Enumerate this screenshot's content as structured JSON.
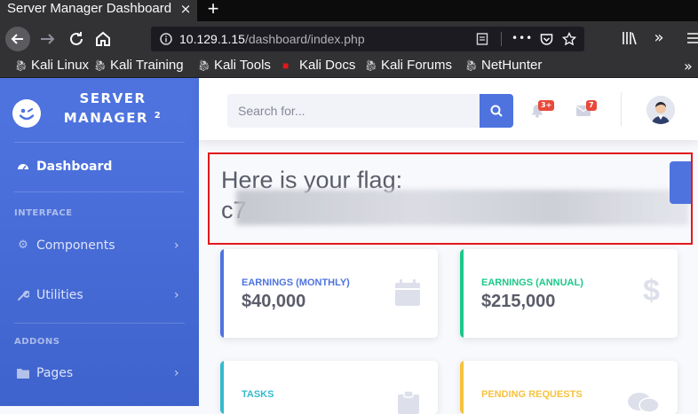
{
  "browser": {
    "tab_title": "Server Manager Dashboard",
    "tab_close": "×",
    "new_tab": "+",
    "url_host": "10.129.1.15",
    "url_path": "/dashboard/index.php",
    "page_actions": "•••",
    "bookmarks": [
      "Kali Linux",
      "Kali Training",
      "Kali Tools",
      "Kali Docs",
      "Kali Forums",
      "NetHunter"
    ],
    "bookmarks_overflow": "»"
  },
  "sidebar": {
    "brand_line1": "SERVER",
    "brand_line2": "MANAGER",
    "brand_sup": "2",
    "dashboard": "Dashboard",
    "heading_interface": "INTERFACE",
    "components": "Components",
    "utilities": "Utilities",
    "heading_addons": "ADDONS",
    "pages": "Pages",
    "chevron": "›"
  },
  "topbar": {
    "search_placeholder": "Search for...",
    "alerts_count": "3+",
    "messages_count": "7"
  },
  "flag": {
    "title": "Here is your flag:",
    "value_visible": "c7"
  },
  "cards": [
    {
      "title": "EARNINGS (MONTHLY)",
      "value": "$40,000",
      "color": "#4e73df"
    },
    {
      "title": "EARNINGS (ANNUAL)",
      "value": "$215,000",
      "color": "#1cc88a"
    },
    {
      "title": "TASKS",
      "value": "",
      "color": "#36b9cc"
    },
    {
      "title": "PENDING REQUESTS",
      "value": "",
      "color": "#f6c23e"
    }
  ],
  "colors": {
    "primary": "#4e73df",
    "success": "#1cc88a",
    "info": "#36b9cc",
    "warning": "#f6c23e",
    "danger": "#e74a3b",
    "highlight_border": "#e0181b"
  }
}
